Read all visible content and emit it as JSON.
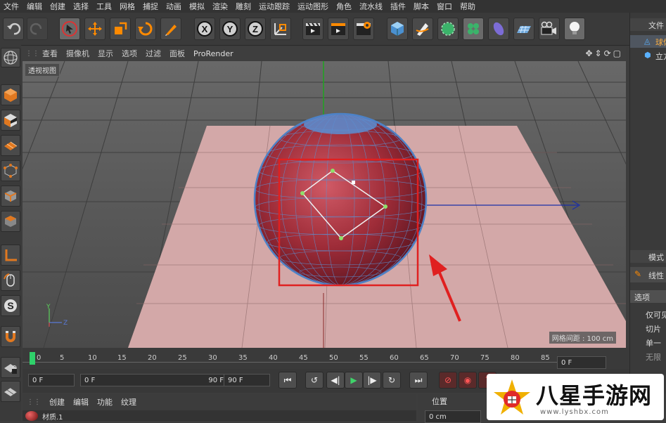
{
  "menu": [
    "文件",
    "编辑",
    "创建",
    "选择",
    "工具",
    "网格",
    "捕捉",
    "动画",
    "模拟",
    "渲染",
    "雕刻",
    "运动跟踪",
    "运动图形",
    "角色",
    "流水线",
    "插件",
    "脚本",
    "窗口",
    "帮助"
  ],
  "viewport_menu": [
    "查看",
    "摄像机",
    "显示",
    "选项",
    "过滤",
    "面板",
    "ProRender"
  ],
  "viewport_label": "透视视图",
  "grid_spacing": "网格间距 : 100 cm",
  "axes": {
    "x": "X",
    "y": "Y",
    "z": "Z"
  },
  "timeline_ticks": [
    "0",
    "5",
    "10",
    "15",
    "20",
    "25",
    "30",
    "35",
    "40",
    "45",
    "50",
    "55",
    "60",
    "65",
    "70",
    "75",
    "80",
    "85"
  ],
  "transport": {
    "start": "0 F",
    "range_start": "0 F",
    "range_end": "90 F",
    "end": "90 F",
    "current": "0 F"
  },
  "material_menu": [
    "创建",
    "编辑",
    "功能",
    "纹理"
  ],
  "material_item": "材质.1",
  "position_panel": {
    "title": "位置",
    "value": "0 cm"
  },
  "right_panel": {
    "header": "文件",
    "objects": [
      "球体",
      "立方体"
    ],
    "mode_header": "模式",
    "mode_item": "线性",
    "options_header": "选项",
    "options": [
      "仅可见",
      "切片",
      "单一",
      "无限"
    ]
  },
  "watermark": {
    "title": "八星手游网",
    "url": "www.lyshbx.com"
  },
  "colors": {
    "accent": "#ff8a00",
    "selection": "#e02020",
    "sphere": "#a8303a",
    "plane": "#d4a8a8"
  }
}
